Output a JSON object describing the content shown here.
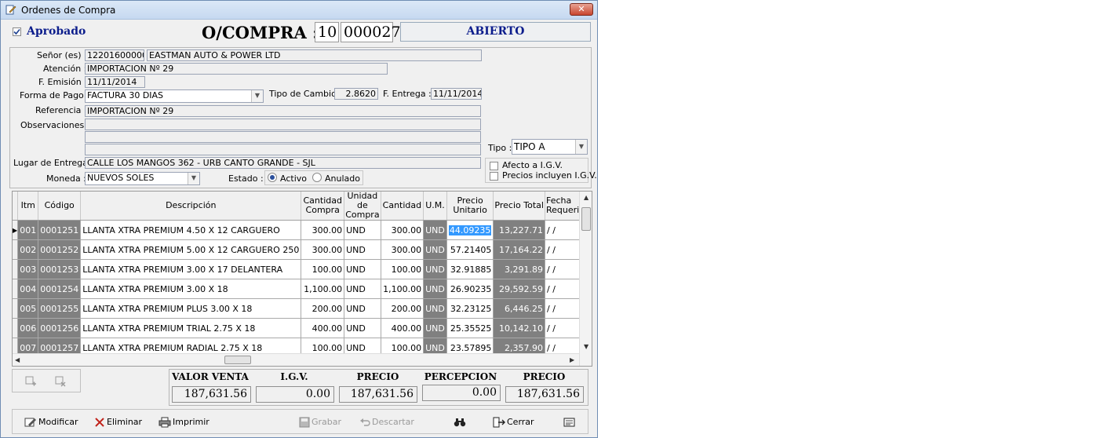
{
  "window": {
    "title": "Ordenes de Compra",
    "close_label": "✕"
  },
  "header": {
    "approved_label": "Aprobado",
    "approved_checked": true,
    "title": "O/COMPRA :",
    "series": "10",
    "number": "000027",
    "status": "ABIERTO"
  },
  "form": {
    "senor_label": "Señor (es) :",
    "senor_code": "12201600000",
    "senor_name": "EASTMAN AUTO & POWER LTD",
    "atencion_label": "Atención :",
    "atencion": "IMPORTACION Nº 29",
    "emision_label": "F. Emisión :",
    "emision": "11/11/2014",
    "forma_pago_label": "Forma de Pago :",
    "forma_pago": "FACTURA 30 DIAS",
    "tipo_cambio_label": "Tipo de Cambio :",
    "tipo_cambio": "2.8620",
    "entrega_label": "F. Entrega :",
    "entrega": "11/11/2014",
    "referencia_label": "Referencia :",
    "referencia": "IMPORTACION Nº 29",
    "observaciones_label": "Observaciones :",
    "observaciones": [
      "",
      "",
      ""
    ],
    "tipo_label": "Tipo :",
    "tipo": "TIPO A",
    "lugar_label": "Lugar de Entrega:",
    "lugar": "CALLE LOS MANGOS 362 - URB CANTO GRANDE - SJL",
    "moneda_label": "Moneda :",
    "moneda": "NUEVOS SOLES",
    "estado_label": "Estado :",
    "estado_activo": "Activo",
    "estado_anulado": "Anulado",
    "afecto_igv": "Afecto a I.G.V.",
    "precios_igv": "Precios incluyen I.G.V."
  },
  "grid": {
    "columns": [
      "Itm",
      "Código",
      "Descripción",
      "Cantidad\nCompra",
      "Unidad de\nCompra",
      "Cantidad",
      "U.M.",
      "Precio\nUnitario",
      "Precio Total",
      "Fecha\nRequerida"
    ],
    "rows": [
      {
        "itm": "001",
        "codigo": "0001251",
        "desc": "LLANTA XTRA PREMIUM 4.50 X 12 CARGUERO",
        "cant_compra": "300.00",
        "unidad": "UND",
        "cantidad": "300.00",
        "um": "UND",
        "precio_unit": "44.09235",
        "precio_total": "13,227.71",
        "fecha": "/ /"
      },
      {
        "itm": "002",
        "codigo": "0001252",
        "desc": "LLANTA XTRA PREMIUM 5.00 X 12 CARGUERO 250",
        "cant_compra": "300.00",
        "unidad": "UND",
        "cantidad": "300.00",
        "um": "UND",
        "precio_unit": "57.21405",
        "precio_total": "17,164.22",
        "fecha": "/ /"
      },
      {
        "itm": "003",
        "codigo": "0001253",
        "desc": "LLANTA XTRA PREMIUM 3.00 X 17 DELANTERA",
        "cant_compra": "100.00",
        "unidad": "UND",
        "cantidad": "100.00",
        "um": "UND",
        "precio_unit": "32.91885",
        "precio_total": "3,291.89",
        "fecha": "/ /"
      },
      {
        "itm": "004",
        "codigo": "0001254",
        "desc": "LLANTA XTRA PREMIUM 3.00 X 18",
        "cant_compra": "1,100.00",
        "unidad": "UND",
        "cantidad": "1,100.00",
        "um": "UND",
        "precio_unit": "26.90235",
        "precio_total": "29,592.59",
        "fecha": "/ /"
      },
      {
        "itm": "005",
        "codigo": "0001255",
        "desc": "LLANTA XTRA PREMIUM PLUS 3.00 X 18",
        "cant_compra": "200.00",
        "unidad": "UND",
        "cantidad": "200.00",
        "um": "UND",
        "precio_unit": "32.23125",
        "precio_total": "6,446.25",
        "fecha": "/ /"
      },
      {
        "itm": "006",
        "codigo": "0001256",
        "desc": "LLANTA XTRA PREMIUM TRIAL 2.75 X 18",
        "cant_compra": "400.00",
        "unidad": "UND",
        "cantidad": "400.00",
        "um": "UND",
        "precio_unit": "25.35525",
        "precio_total": "10,142.10",
        "fecha": "/ /"
      },
      {
        "itm": "007",
        "codigo": "0001257",
        "desc": "LLANTA XTRA PREMIUM RADIAL 2.75 X 18",
        "cant_compra": "100.00",
        "unidad": "UND",
        "cantidad": "100.00",
        "um": "UND",
        "precio_unit": "23.57895",
        "precio_total": "2,357.90",
        "fecha": "/ /"
      }
    ]
  },
  "totals": {
    "valor_venta_label": "VALOR VENTA",
    "valor_venta": "187,631.56",
    "igv_label": "I.G.V.",
    "igv": "0.00",
    "precio_venta_label": "PRECIO VENTA",
    "precio_venta": "187,631.56",
    "percepcion_label": "PERCEPCION",
    "percepcion": "0.00",
    "precio_venta2_label": "PRECIO VENTA",
    "precio_venta2": "187,631.56"
  },
  "toolbar": {
    "modificar": "Modificar",
    "eliminar": "Eliminar",
    "imprimir": "Imprimir",
    "grabar": "Grabar",
    "descartar": "Descartar",
    "cerrar": "Cerrar"
  }
}
